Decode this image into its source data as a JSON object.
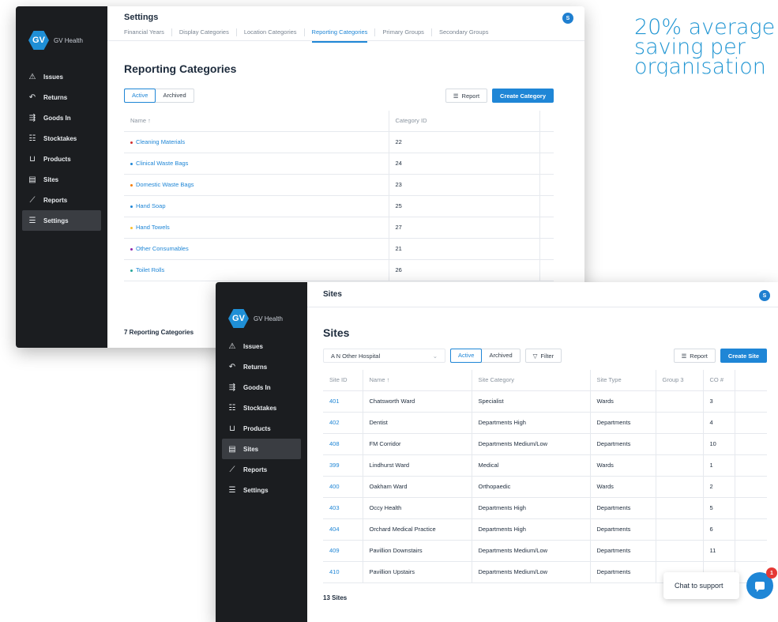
{
  "tagline": [
    "20% average",
    "saving per",
    "organisation"
  ],
  "colors": {
    "accent": "#1f86d6",
    "sidebar": "#1b1d20",
    "tagline": "#2196d3"
  },
  "brand": {
    "logo": "GV",
    "name": "GV Health"
  },
  "nav": [
    {
      "icon": "issues-icon",
      "glyph": "⚠",
      "label": "Issues"
    },
    {
      "icon": "returns-icon",
      "glyph": "↶",
      "label": "Returns"
    },
    {
      "icon": "goods-in-icon",
      "glyph": "⇶",
      "label": "Goods In"
    },
    {
      "icon": "stocktakes-icon",
      "glyph": "☷",
      "label": "Stocktakes"
    },
    {
      "icon": "products-icon",
      "glyph": "⊔",
      "label": "Products"
    },
    {
      "icon": "sites-icon",
      "glyph": "▤",
      "label": "Sites"
    },
    {
      "icon": "reports-icon",
      "glyph": "⟋",
      "label": "Reports"
    },
    {
      "icon": "settings-icon",
      "glyph": "☰",
      "label": "Settings"
    }
  ],
  "settings": {
    "title": "Settings",
    "avatar": "S",
    "tabs": [
      "Financial Years",
      "Display Categories",
      "Location Categories",
      "Reporting Categories",
      "Primary Groups",
      "Secondary Groups"
    ],
    "active_tab": "Reporting Categories",
    "heading": "Reporting Categories",
    "seg_active": "Active",
    "seg_archived": "Archived",
    "report_label": "Report",
    "create_label": "Create Category",
    "columns": [
      "Name ↑",
      "Category ID"
    ],
    "rows": [
      {
        "name": "Cleaning Materials",
        "id": "22",
        "color": "#d32f2f"
      },
      {
        "name": "Clinical Waste Bags",
        "id": "24",
        "color": "#1f86d6"
      },
      {
        "name": "Domestic Waste Bags",
        "id": "23",
        "color": "#f57c00"
      },
      {
        "name": "Hand Soap",
        "id": "25",
        "color": "#1f86d6"
      },
      {
        "name": "Hand Towels",
        "id": "27",
        "color": "#fbc02d"
      },
      {
        "name": "Other Consumables",
        "id": "21",
        "color": "#8e24aa"
      },
      {
        "name": "Toilet Rolls",
        "id": "26",
        "color": "#26a69a"
      }
    ],
    "footer": "7 Reporting Categories"
  },
  "sites": {
    "title": "Sites",
    "avatar": "S",
    "heading": "Sites",
    "site_select": "A N Other Hospital",
    "seg_active": "Active",
    "seg_archived": "Archived",
    "filter_label": "Filter",
    "report_label": "Report",
    "create_label": "Create Site",
    "columns": [
      "Site ID",
      "Name ↑",
      "Site Category",
      "Site Type",
      "Group 3",
      "CO #"
    ],
    "rows": [
      {
        "id": "401",
        "name": "Chatsworth Ward",
        "category": "Specialist",
        "type": "Wards",
        "group": "",
        "co": "3"
      },
      {
        "id": "402",
        "name": "Dentist",
        "category": "Departments High",
        "type": "Departments",
        "group": "",
        "co": "4"
      },
      {
        "id": "408",
        "name": "FM Corridor",
        "category": "Departments Medium/Low",
        "type": "Departments",
        "group": "",
        "co": "10"
      },
      {
        "id": "399",
        "name": "Lindhurst Ward",
        "category": "Medical",
        "type": "Wards",
        "group": "",
        "co": "1"
      },
      {
        "id": "400",
        "name": "Oakham Ward",
        "category": "Orthopaedic",
        "type": "Wards",
        "group": "",
        "co": "2"
      },
      {
        "id": "403",
        "name": "Occy Health",
        "category": "Departments High",
        "type": "Departments",
        "group": "",
        "co": "5"
      },
      {
        "id": "404",
        "name": "Orchard Medical Practice",
        "category": "Departments High",
        "type": "Departments",
        "group": "",
        "co": "6"
      },
      {
        "id": "409",
        "name": "Pavillion Downstairs",
        "category": "Departments Medium/Low",
        "type": "Departments",
        "group": "",
        "co": "11"
      },
      {
        "id": "410",
        "name": "Pavillion Upstairs",
        "category": "Departments Medium/Low",
        "type": "Departments",
        "group": "",
        "co": ""
      }
    ],
    "footer": "13 Sites"
  },
  "chat": {
    "label": "Chat to support",
    "badge": "1"
  }
}
